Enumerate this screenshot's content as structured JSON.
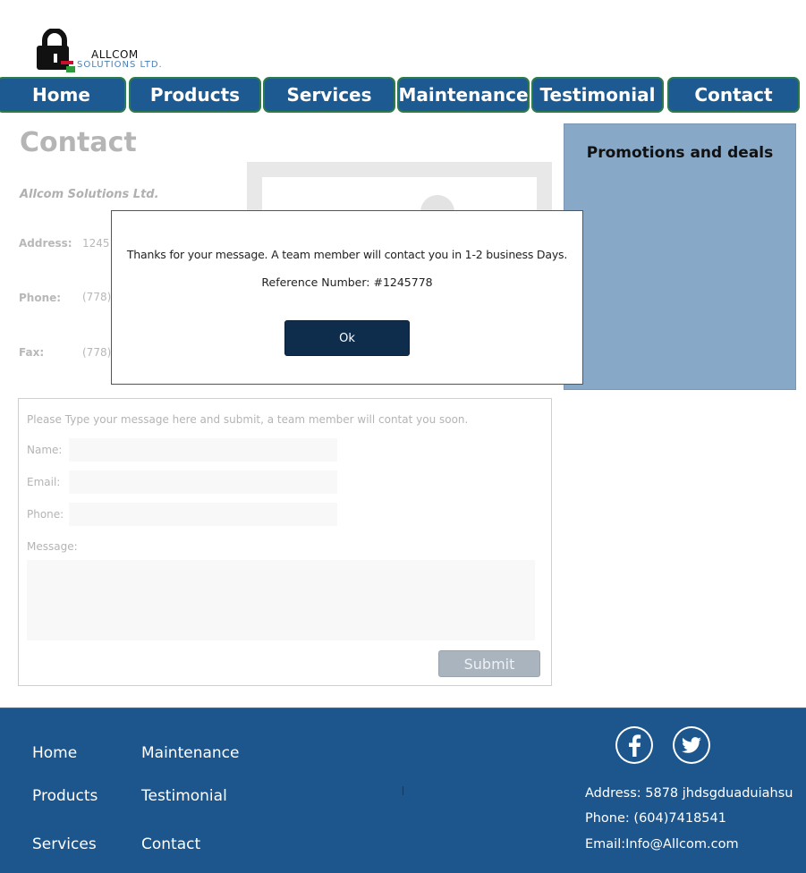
{
  "logo": {
    "line1": "ALLCOM",
    "line2": "SOLUTIONS LTD.",
    "icon": "padlock-logo-icon"
  },
  "nav": {
    "items": [
      {
        "label": "Home"
      },
      {
        "label": "Products"
      },
      {
        "label": "Services"
      },
      {
        "label": "Maintenance"
      },
      {
        "label": "Testimonial"
      },
      {
        "label": "Contact"
      }
    ]
  },
  "main": {
    "title": "Contact",
    "company": "Allcom Solutions Ltd.",
    "address_label": "Address:",
    "address_value": "1245",
    "phone_label": "Phone:",
    "phone_value": "(778)",
    "fax_label": "Fax:",
    "fax_value": "(778)"
  },
  "promo": {
    "title": "Promotions and deals"
  },
  "form": {
    "intro": "Please Type your message here and submit, a team member will contat you soon.",
    "name_label": "Name:",
    "email_label": "Email:",
    "phone_label": "Phone:",
    "message_label": "Message:",
    "name_value": "",
    "email_value": "",
    "phone_value": "",
    "message_value": "",
    "submit_label": "Submit"
  },
  "modal": {
    "message": "Thanks for your message. A team member will contact you in 1-2 business Days.",
    "reference": "Reference Number: #1245778",
    "ok_label": "Ok"
  },
  "footer": {
    "links_col1": [
      "Home",
      "Products",
      "Services"
    ],
    "links_col2": [
      "Maintenance",
      "Testimonial",
      "Contact"
    ],
    "social": [
      "facebook-icon",
      "twitter-icon"
    ],
    "address": "Address: 5878 jhdsgduaduiahsu",
    "phone": "Phone: (604)7418541",
    "email": "Email:Info@Allcom.com"
  },
  "colors": {
    "nav_bg": "#1c5a91",
    "nav_border": "#2e7a4a",
    "footer_bg": "#1c568c",
    "promo_bg": "#87a8c6",
    "ok_button": "#0e2c4c"
  }
}
